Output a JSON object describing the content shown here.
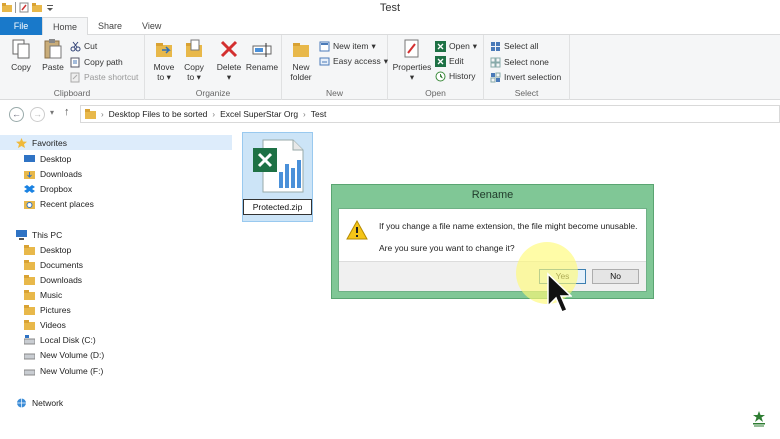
{
  "window": {
    "title": "Test"
  },
  "tabs": [
    "File",
    "Home",
    "Share",
    "View"
  ],
  "ribbon": {
    "clipboard": {
      "label": "Clipboard",
      "copy": "Copy",
      "paste": "Paste",
      "cut": "Cut",
      "copy_path": "Copy path",
      "paste_shortcut": "Paste shortcut"
    },
    "organize": {
      "label": "Organize",
      "move_to": "Move",
      "move_to2": "to",
      "copy_to": "Copy",
      "copy_to2": "to",
      "delete": "Delete",
      "rename": "Rename"
    },
    "new": {
      "label": "New",
      "new_folder": "New",
      "new_folder2": "folder",
      "new_item": "New item",
      "easy_access": "Easy access"
    },
    "open": {
      "label": "Open",
      "properties": "Properties",
      "open": "Open",
      "edit": "Edit",
      "history": "History"
    },
    "select": {
      "label": "Select",
      "select_all": "Select all",
      "select_none": "Select none",
      "invert": "Invert selection"
    }
  },
  "breadcrumb": [
    "Desktop Files to be sorted",
    "Excel SuperStar Org",
    "Test"
  ],
  "nav": {
    "favorites": "Favorites",
    "fav_items": [
      "Desktop",
      "Downloads",
      "Dropbox",
      "Recent places"
    ],
    "this_pc": "This PC",
    "pc_items": [
      "Desktop",
      "Documents",
      "Downloads",
      "Music",
      "Pictures",
      "Videos",
      "Local Disk (C:)",
      "New Volume (D:)",
      "New Volume (F:)"
    ],
    "network": "Network"
  },
  "file": {
    "name": "Protected.zip"
  },
  "dialog": {
    "title": "Rename",
    "message1": "If you change a file name extension, the file might become unusable.",
    "message2": "Are you sure you want to change it?",
    "yes": "Yes",
    "no": "No"
  },
  "colors": {
    "file_tab": "#1979ca",
    "dialog_frame": "#80c796",
    "selection": "#cce4f7"
  }
}
